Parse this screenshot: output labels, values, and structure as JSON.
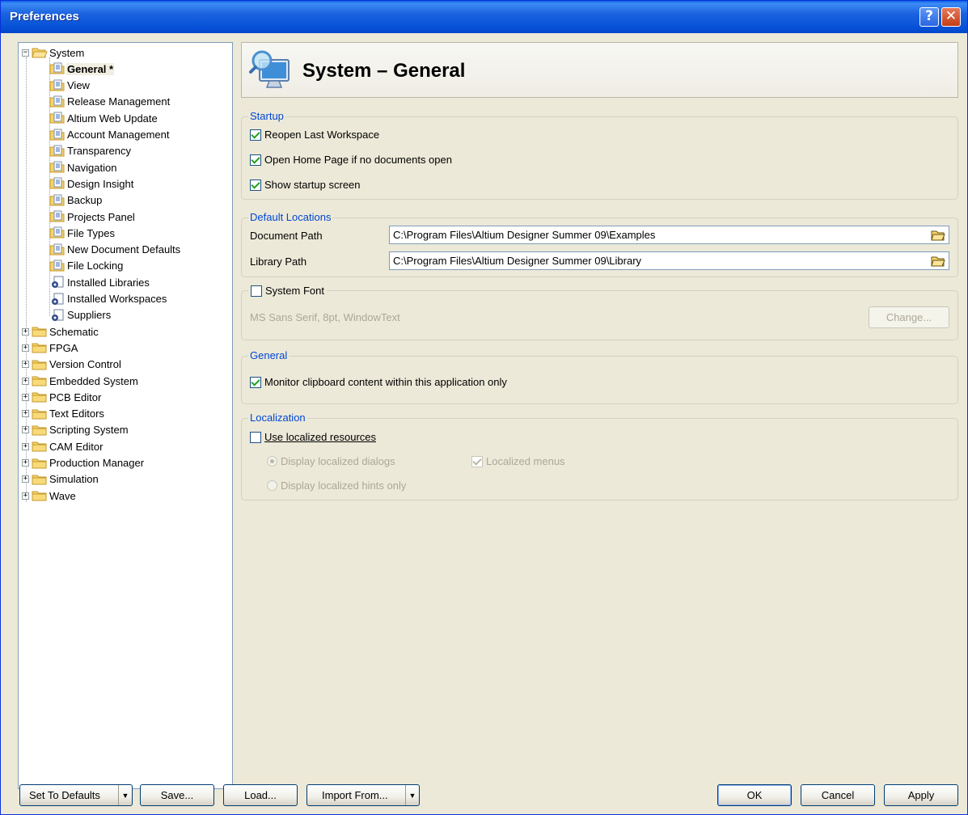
{
  "window": {
    "title": "Preferences"
  },
  "tree": {
    "root": {
      "label": "System"
    },
    "system_children": [
      {
        "label": "General *",
        "selected": true,
        "icon": "page-icon"
      },
      {
        "label": "View",
        "icon": "page-icon"
      },
      {
        "label": "Release Management",
        "icon": "page-icon"
      },
      {
        "label": "Altium Web Update",
        "icon": "page-icon"
      },
      {
        "label": "Account Management",
        "icon": "page-icon"
      },
      {
        "label": "Transparency",
        "icon": "page-icon"
      },
      {
        "label": "Navigation",
        "icon": "page-icon"
      },
      {
        "label": "Design Insight",
        "icon": "page-icon"
      },
      {
        "label": "Backup",
        "icon": "page-icon"
      },
      {
        "label": "Projects Panel",
        "icon": "page-icon"
      },
      {
        "label": "File Types",
        "icon": "page-icon"
      },
      {
        "label": "New Document Defaults",
        "icon": "page-icon"
      },
      {
        "label": "File Locking",
        "icon": "page-icon"
      },
      {
        "label": "Installed Libraries",
        "icon": "gear-page-icon"
      },
      {
        "label": "Installed Workspaces",
        "icon": "gear-page-icon"
      },
      {
        "label": "Suppliers",
        "icon": "gear-page-icon"
      }
    ],
    "top_folders": [
      {
        "label": "Schematic"
      },
      {
        "label": "FPGA"
      },
      {
        "label": "Version Control"
      },
      {
        "label": "Embedded System"
      },
      {
        "label": "PCB Editor"
      },
      {
        "label": "Text Editors"
      },
      {
        "label": "Scripting System"
      },
      {
        "label": "CAM Editor"
      },
      {
        "label": "Production Manager"
      },
      {
        "label": "Simulation"
      },
      {
        "label": "Wave"
      }
    ]
  },
  "header": {
    "title": "System – General",
    "icon": "monitor-search-icon"
  },
  "startup": {
    "title": "Startup",
    "options": [
      {
        "label": "Reopen Last Workspace",
        "checked": true
      },
      {
        "label": "Open Home Page if no documents open",
        "checked": true
      },
      {
        "label": "Show startup screen",
        "checked": true
      }
    ]
  },
  "default_locations": {
    "title": "Default Locations",
    "document_path_label": "Document Path",
    "document_path_value": "C:\\Program Files\\Altium Designer Summer 09\\Examples",
    "library_path_label": "Library Path",
    "library_path_value": "C:\\Program Files\\Altium Designer Summer 09\\Library"
  },
  "system_font": {
    "title": "System Font",
    "checked": false,
    "font_description": "MS Sans Serif, 8pt, WindowText",
    "change_button": "Change..."
  },
  "general": {
    "title": "General",
    "monitor_clipboard_label": "Monitor clipboard content within this application only",
    "monitor_clipboard_checked": true
  },
  "localization": {
    "title": "Localization",
    "use_localized_label": "Use localized resources",
    "use_localized_checked": false,
    "display_dialogs_label": "Display localized dialogs",
    "display_hints_label": "Display localized hints only",
    "localized_menus_label": "Localized menus",
    "localized_menus_checked": true
  },
  "footer": {
    "set_to_defaults": "Set To Defaults",
    "save": "Save...",
    "load": "Load...",
    "import_from": "Import From...",
    "ok": "OK",
    "cancel": "Cancel",
    "apply": "Apply"
  },
  "colors": {
    "titlebar": "#0a5ee8",
    "group_title": "#0046d5",
    "check_mark": "#21a121",
    "dialog_bg": "#ece9d8"
  }
}
